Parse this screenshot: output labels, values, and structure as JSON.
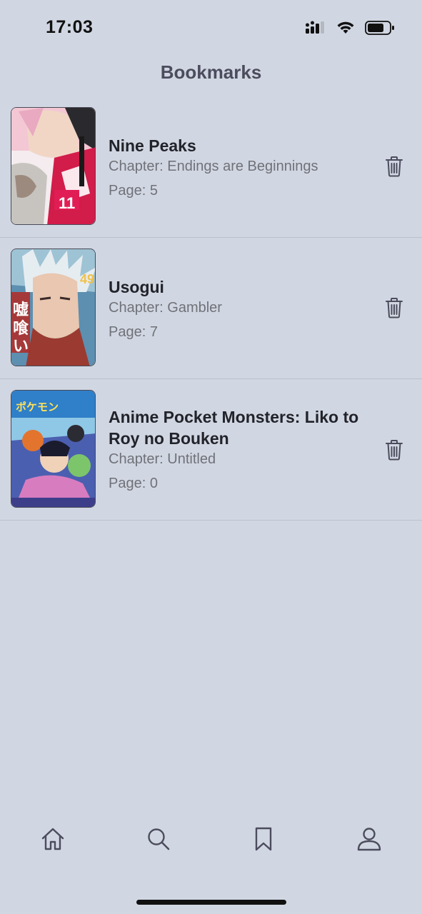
{
  "status_bar": {
    "time": "17:03"
  },
  "header": {
    "title": "Bookmarks"
  },
  "bookmarks": [
    {
      "title": "Nine Peaks",
      "chapter": "Chapter: Endings are Beginnings",
      "page": "Page: 5",
      "cover_text": "11"
    },
    {
      "title": "Usogui",
      "chapter": "Chapter: Gambler",
      "page": "Page: 7",
      "cover_text": "嘘喰い"
    },
    {
      "title": "Anime Pocket Monsters: Liko to Roy no Bouken",
      "chapter": "Chapter: Untitled",
      "page": "Page: 0",
      "cover_text": "ポケットモンスター"
    }
  ],
  "tabbar": {
    "tabs": [
      {
        "icon": "home-icon",
        "active": false
      },
      {
        "icon": "search-icon",
        "active": false
      },
      {
        "icon": "bookmark-icon",
        "active": true
      },
      {
        "icon": "profile-icon",
        "active": false
      }
    ]
  },
  "colors": {
    "background": "#d1d7e2",
    "title_text": "#22232a",
    "secondary_text": "#707178",
    "icon": "#4b4c5d"
  }
}
